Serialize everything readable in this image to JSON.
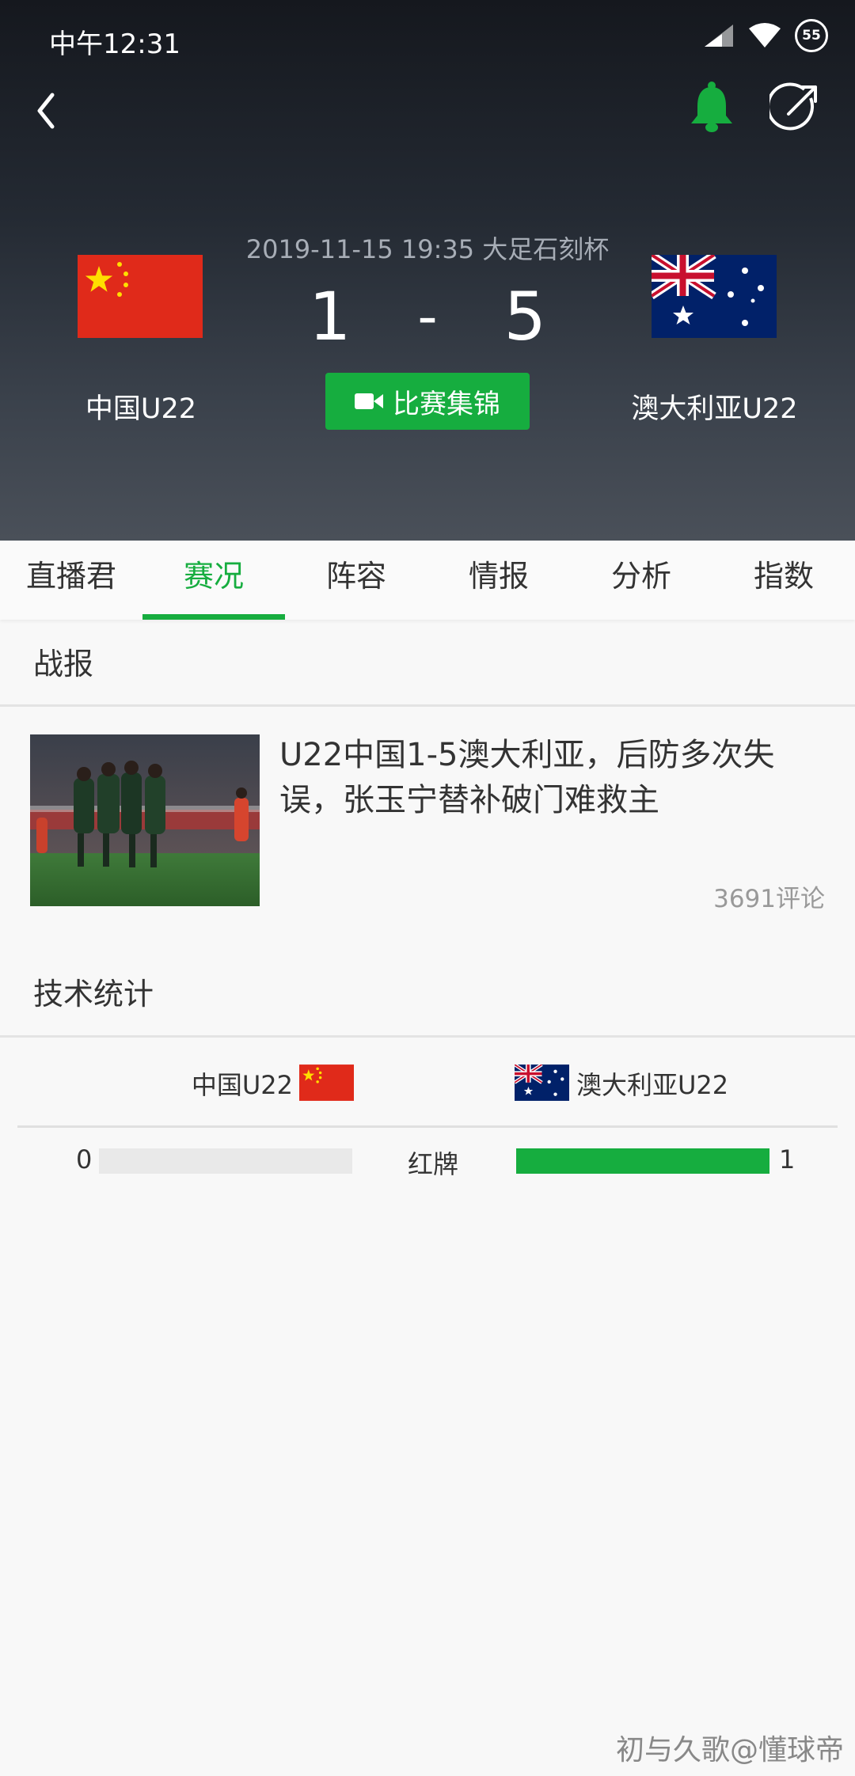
{
  "status_bar": {
    "time": "中午12:31",
    "battery": "55"
  },
  "header": {
    "match_info": "2019-11-15 19:35 大足石刻杯",
    "home_team": "中国U22",
    "away_team": "澳大利亚U22",
    "home_score": "1",
    "separator": "-",
    "away_score": "5",
    "highlight_label": "比赛集锦",
    "accent_color": "#16ad3f"
  },
  "tabs": [
    {
      "label": "直播君",
      "active": false
    },
    {
      "label": "赛况",
      "active": true
    },
    {
      "label": "阵容",
      "active": false
    },
    {
      "label": "情报",
      "active": false
    },
    {
      "label": "分析",
      "active": false
    },
    {
      "label": "指数",
      "active": false
    }
  ],
  "report": {
    "title": "战报",
    "news_title": "U22中国1-5澳大利亚，后防多次失误，张玉宁替补破门难救主",
    "comments": "3691评论"
  },
  "stats": {
    "title": "技术统计",
    "home_label": "中国U22",
    "away_label": "澳大利亚U22",
    "rows": [
      {
        "label": "红牌",
        "home": "0",
        "away": "1",
        "home_share": 0,
        "away_share": 1
      }
    ]
  },
  "watermark": "初与久歌@懂球帝"
}
